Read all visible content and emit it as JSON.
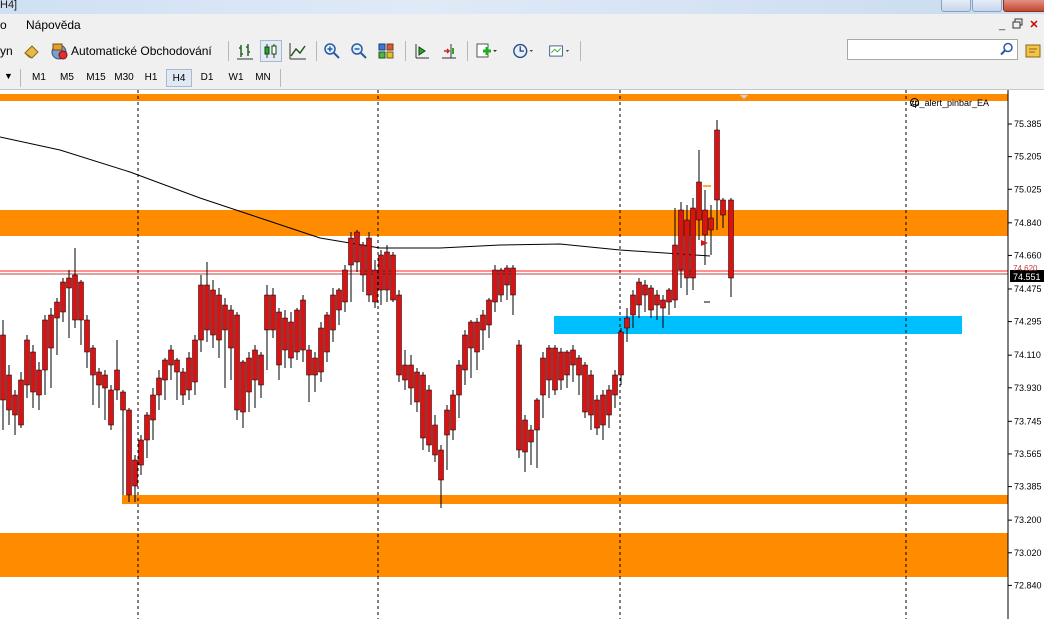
{
  "window": {
    "title_fragment": "H4]"
  },
  "menu": {
    "items": [
      {
        "label": "o"
      },
      {
        "label": "Nápověda"
      }
    ]
  },
  "toolbar": {
    "fragment_label": "yn",
    "algo_trading_label": "Automatické Obchodování",
    "search": {
      "value": "",
      "placeholder": ""
    }
  },
  "timeframes": [
    {
      "label": "M1"
    },
    {
      "label": "M5"
    },
    {
      "label": "M15"
    },
    {
      "label": "M30"
    },
    {
      "label": "H1"
    },
    {
      "label": "H4",
      "active": true
    },
    {
      "label": "D1"
    },
    {
      "label": "W1"
    },
    {
      "label": "MN"
    }
  ],
  "chart": {
    "indicator_label": "zp_alert_pinbar_EA",
    "current_price_label": "74.551",
    "hidden_price_label": "74.620",
    "price_axis_labels": [
      "75.385",
      "75.205",
      "75.025",
      "74.840",
      "74.660",
      "74.475",
      "74.295",
      "74.110",
      "73.930",
      "73.565",
      "73.385",
      "73.200",
      "73.020",
      "72.840",
      "73.745"
    ],
    "colors": {
      "bull": "#22bb33",
      "bear": "#dd1111",
      "zone_orange": "#ff8c00",
      "zone_blue": "#00bfff",
      "ma_line": "#000000",
      "bid_line": "#ff2020"
    }
  }
}
